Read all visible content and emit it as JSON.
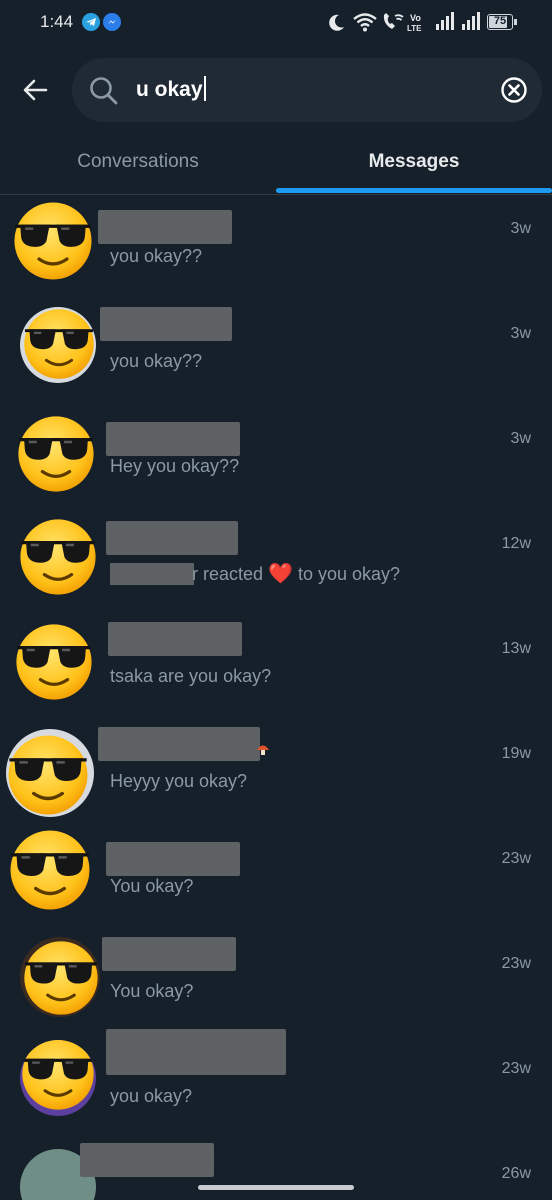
{
  "status_bar": {
    "time": "1:44",
    "battery": "75"
  },
  "search": {
    "query": "u okay"
  },
  "tabs": [
    {
      "label": "Conversations",
      "active": false
    },
    {
      "label": "Messages",
      "active": true
    }
  ],
  "results": [
    {
      "message": "you okay??",
      "time": "3w"
    },
    {
      "message": "you okay??",
      "time": "3w"
    },
    {
      "message": "Hey you okay??",
      "time": "3w"
    },
    {
      "message_suffix": "r reacted",
      "message_end": "to you okay?",
      "reaction": "❤️",
      "time": "12w"
    },
    {
      "message": "tsaka are you okay?",
      "time": "13w"
    },
    {
      "message": "Heyyy you okay?",
      "time": "19w"
    },
    {
      "message": "You okay?",
      "time": "23w"
    },
    {
      "message": "You okay?",
      "time": "23w"
    },
    {
      "message": "you okay?",
      "time": "23w"
    },
    {
      "message": "",
      "time": "26w"
    }
  ],
  "colors": {
    "background": "#15202b",
    "accent": "#1d9bf0",
    "secondary_text": "#8b98a5"
  }
}
